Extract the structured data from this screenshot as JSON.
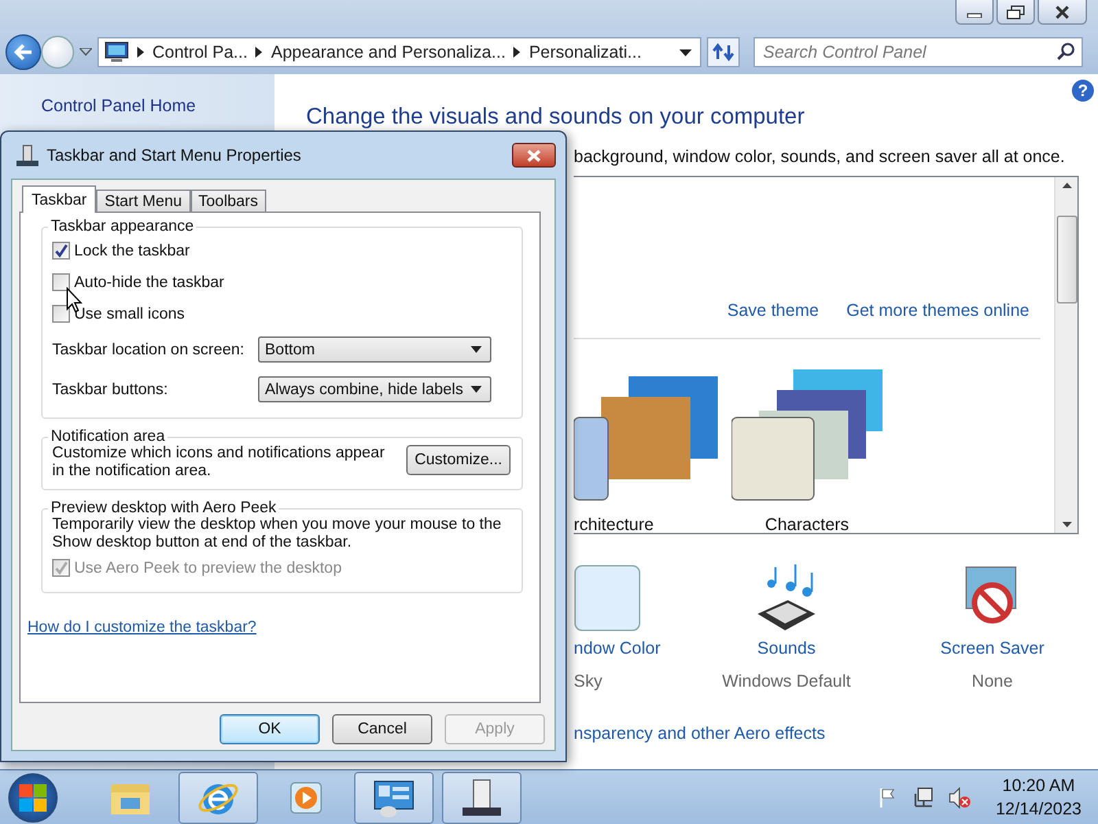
{
  "address_bar": {
    "breadcrumbs": [
      "Control Pa...",
      "Appearance and Personaliza...",
      "Personalizati..."
    ]
  },
  "search": {
    "placeholder": "Search Control Panel"
  },
  "sidebar": {
    "items": [
      "Control Panel Home"
    ]
  },
  "content": {
    "help": "?",
    "heading": "Change the visuals and sounds on your computer",
    "subtitle": "background, window color, sounds, and screen saver all at once.",
    "theme_links": [
      "Save theme",
      "Get more themes online"
    ],
    "themes": [
      {
        "name": "rchitecture",
        "kind": "architecture"
      },
      {
        "name": "Characters",
        "kind": "characters"
      }
    ],
    "settings": [
      {
        "kind": "color",
        "label": "ndow Color",
        "value": "Sky"
      },
      {
        "kind": "sounds",
        "label": "Sounds",
        "value": "Windows Default"
      },
      {
        "kind": "screensaver",
        "label": "Screen Saver",
        "value": "None"
      }
    ],
    "aero_link": "nsparency and other Aero effects"
  },
  "dialog": {
    "title": "Taskbar and Start Menu Properties",
    "tabs": [
      {
        "label": "Taskbar",
        "selected": true
      },
      {
        "label": "Start Menu",
        "selected": false
      },
      {
        "label": "Toolbars",
        "selected": false
      }
    ],
    "appearance": {
      "title": "Taskbar appearance",
      "checkboxes": [
        {
          "label": "Lock the taskbar",
          "checked": true
        },
        {
          "label": "Auto-hide the taskbar",
          "checked": false
        },
        {
          "label": "Use small icons",
          "checked": false
        }
      ],
      "dropdowns": [
        {
          "label": "Taskbar location on screen:",
          "value": "Bottom"
        },
        {
          "label": "Taskbar buttons:",
          "value": "Always combine, hide labels"
        }
      ]
    },
    "notification": {
      "title": "Notification area",
      "text": "Customize which icons and notifications appear in the notification area.",
      "button": "Customize..."
    },
    "peek": {
      "title": "Preview desktop with Aero Peek",
      "text": "Temporarily view the desktop when you move your mouse to the Show desktop button at end of the taskbar.",
      "checkbox": {
        "label": "Use Aero Peek to preview the desktop",
        "checked": true,
        "disabled": true
      }
    },
    "help_link": "How do I customize the taskbar?",
    "buttons": [
      {
        "label": "OK",
        "default": true,
        "disabled": false
      },
      {
        "label": "Cancel",
        "default": false,
        "disabled": false
      },
      {
        "label": "Apply",
        "default": false,
        "disabled": true
      }
    ]
  },
  "taskbar": {
    "apps": [
      {
        "kind": "folder",
        "active": false
      },
      {
        "kind": "browser",
        "active": true
      },
      {
        "kind": "media",
        "active": false
      },
      {
        "kind": "panel",
        "active": true
      },
      {
        "kind": "properties",
        "active": true
      }
    ],
    "time": "10:20 AM",
    "date": "12/14/2023"
  }
}
